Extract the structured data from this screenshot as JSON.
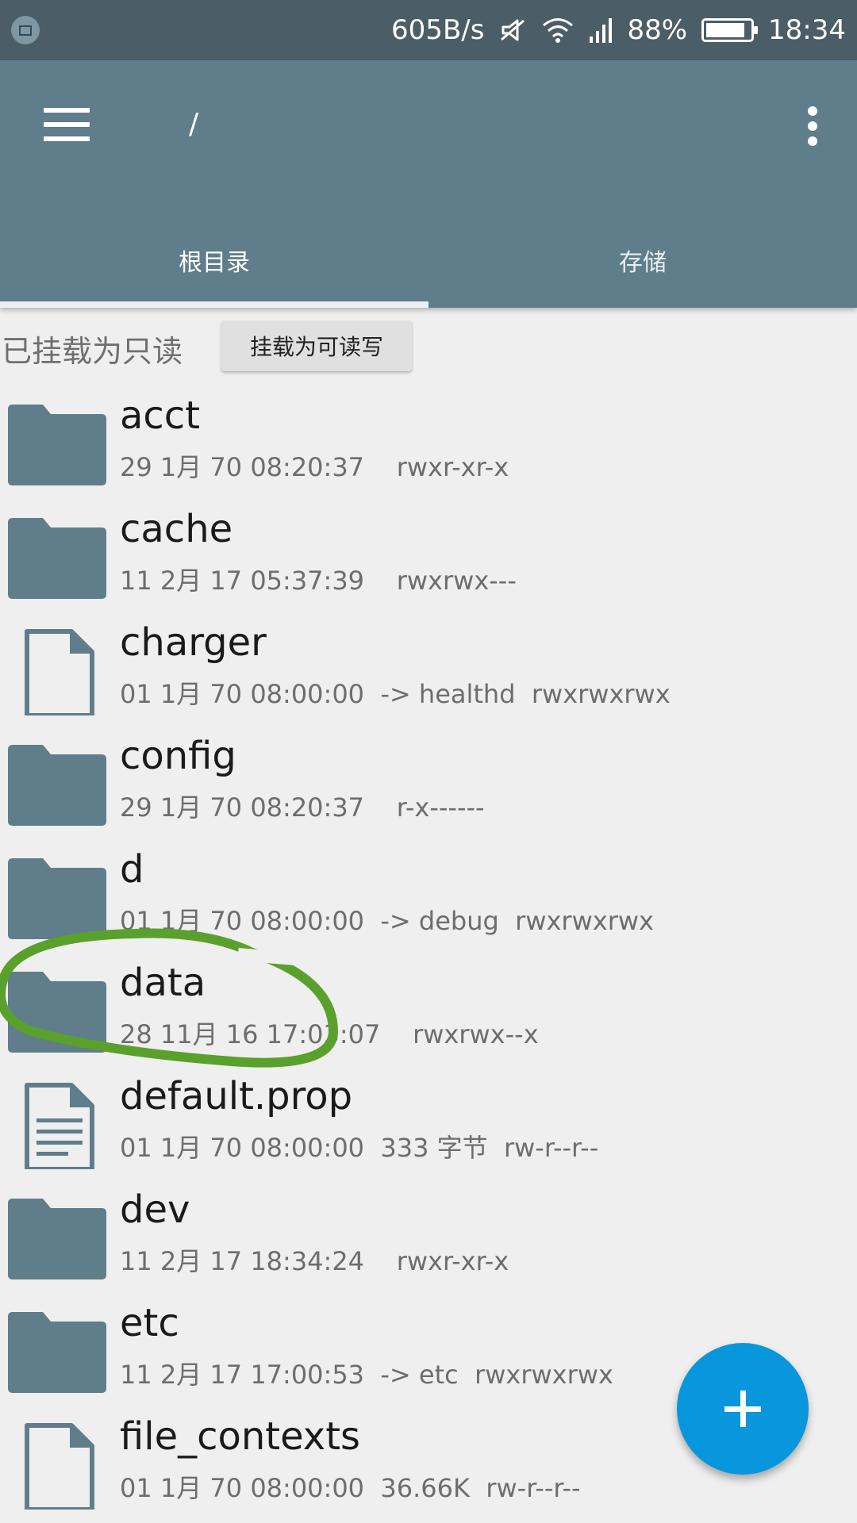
{
  "status_bar": {
    "speed": "605B/s",
    "battery": "88%",
    "battery_level": 0.88,
    "time": "18:34"
  },
  "app_bar": {
    "path": "/",
    "tabs": [
      {
        "label": "根目录",
        "selected": true
      },
      {
        "label": "存储",
        "selected": false
      }
    ]
  },
  "mount": {
    "status": "已挂载为只读",
    "button_label": "挂载为可读写"
  },
  "files": [
    {
      "name": "acct",
      "meta": "29 1月 70 08:20:37    rwxr-xr-x",
      "type": "folder-icon"
    },
    {
      "name": "cache",
      "meta": "11 2月 17 05:37:39    rwxrwx---",
      "type": "folder-icon"
    },
    {
      "name": "charger",
      "meta": "01 1月 70 08:00:00  -> healthd  rwxrwxrwx",
      "type": "file-icon"
    },
    {
      "name": "config",
      "meta": "29 1月 70 08:20:37    r-x------",
      "type": "folder-icon"
    },
    {
      "name": "d",
      "meta": "01 1月 70 08:00:00  -> debug  rwxrwxrwx",
      "type": "folder-icon"
    },
    {
      "name": "data",
      "meta": "28 11月 16 17:03:07    rwxrwx--x",
      "type": "folder-icon"
    },
    {
      "name": "default.prop",
      "meta": "01 1月 70 08:00:00  333 字节  rw-r--r--",
      "type": "text-file-icon"
    },
    {
      "name": "dev",
      "meta": "11 2月 17 18:34:24    rwxr-xr-x",
      "type": "folder-icon"
    },
    {
      "name": "etc",
      "meta": "11 2月 17 17:00:53  -> etc  rwxrwxrwx",
      "type": "folder-icon"
    },
    {
      "name": "file_contexts",
      "meta": "01 1月 70 08:00:00  36.66K  rw-r--r--",
      "type": "file-icon"
    }
  ],
  "colors": {
    "status_bar": "#4b5d66",
    "app_bar": "#607d8b",
    "fab": "#0897dc",
    "annotation": "#5aa02c"
  }
}
